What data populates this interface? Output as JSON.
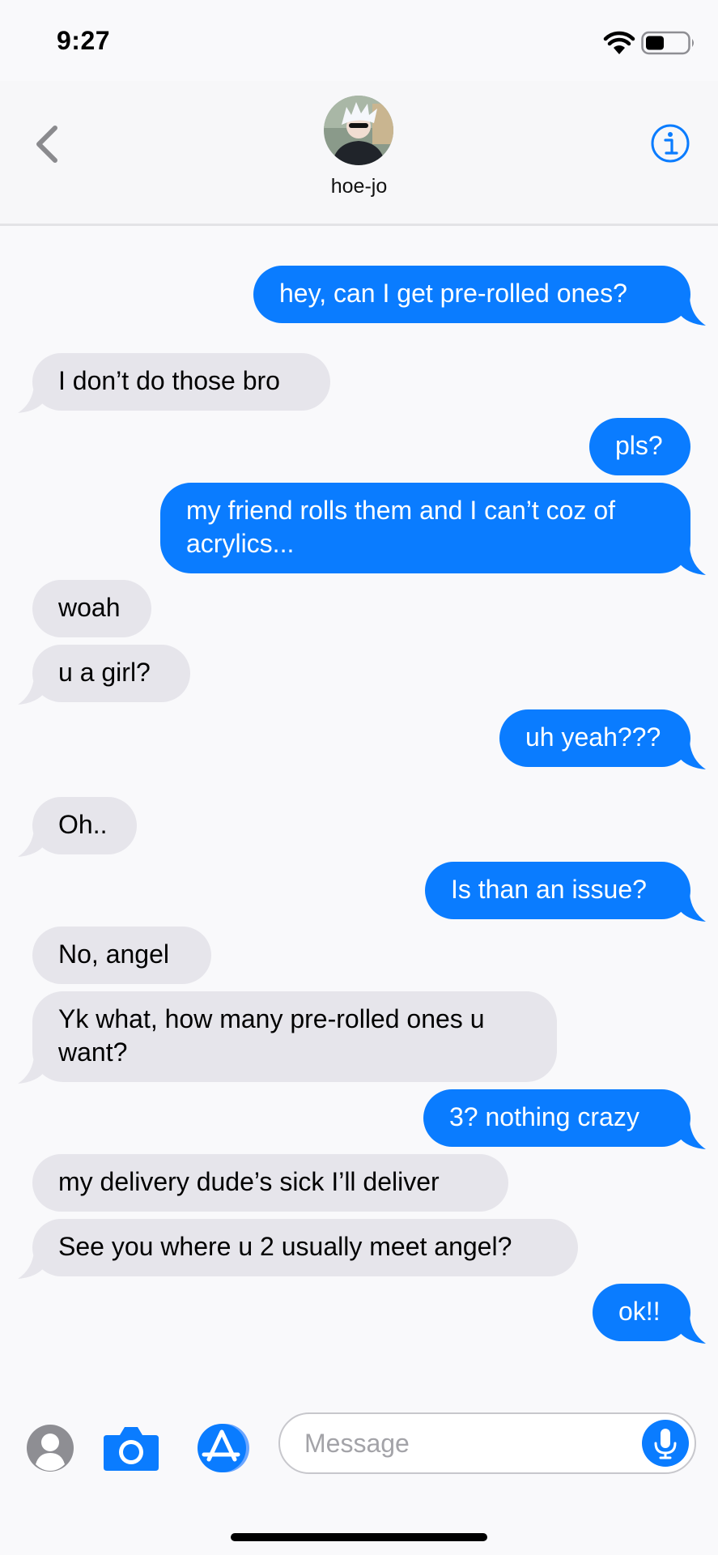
{
  "status_bar": {
    "time": "9:27"
  },
  "header": {
    "contact_name": "hoe-jo"
  },
  "messages": [
    {
      "from": "me",
      "text": "hey, can I get pre-rolled ones?"
    },
    {
      "from": "them",
      "text": "I don’t do those bro"
    },
    {
      "from": "me",
      "text": "pls?"
    },
    {
      "from": "me",
      "text": "my friend rolls them and I can’t coz of acrylics..."
    },
    {
      "from": "them",
      "text": "woah"
    },
    {
      "from": "them",
      "text": "u a girl?"
    },
    {
      "from": "me",
      "text": "uh yeah???"
    },
    {
      "from": "them",
      "text": "Oh.."
    },
    {
      "from": "me",
      "text": "Is than an issue?"
    },
    {
      "from": "them",
      "text": "No, angel"
    },
    {
      "from": "them",
      "text": "Yk what, how many pre-rolled ones u want?"
    },
    {
      "from": "me",
      "text": "3? nothing crazy"
    },
    {
      "from": "them",
      "text": "my delivery dude’s sick I’ll deliver"
    },
    {
      "from": "them",
      "text": "See you where u 2 usually meet angel?"
    },
    {
      "from": "me",
      "text": "ok!!"
    }
  ],
  "input_bar": {
    "placeholder": "Message"
  },
  "colors": {
    "sent": "#0a7cff",
    "received": "#e6e5eb",
    "accent": "#0a7cff"
  }
}
